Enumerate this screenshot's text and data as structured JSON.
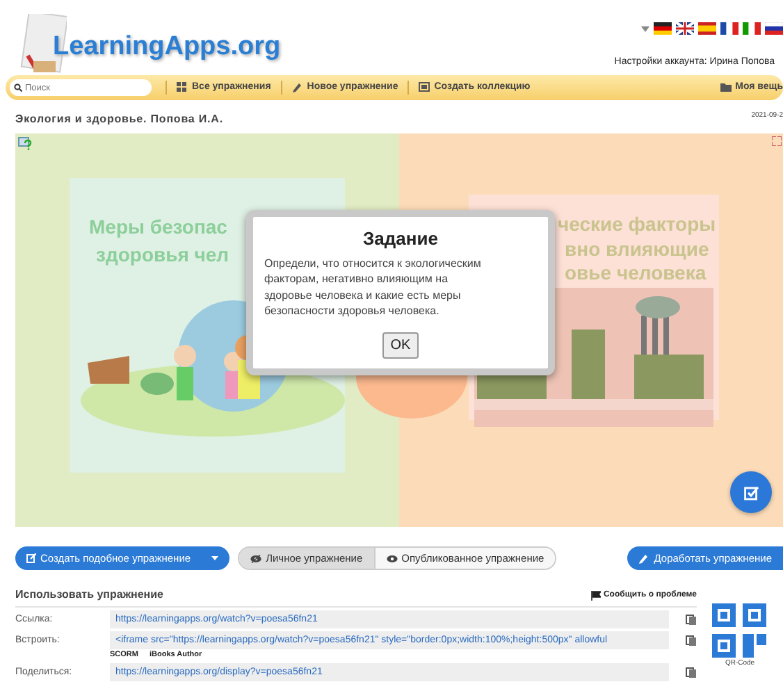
{
  "logo": {
    "text": "LearningApps.org"
  },
  "account": "Настройки аккаунта: Ирина Попова",
  "nav": {
    "search": {
      "placeholder": "Поиск"
    },
    "items": [
      {
        "label": "Все упражнения",
        "kind": "grid"
      },
      {
        "label": "Новое упражнение",
        "kind": "pencil"
      },
      {
        "label": "Создать коллекцию",
        "kind": "collection"
      }
    ],
    "right": {
      "label": "Моя вещь",
      "kind": "folder"
    }
  },
  "title": "Экология и здоровье. Попова И.А.",
  "date": "2021-09-2",
  "exercise": {
    "panels": [
      {
        "lines": [
          "Меры безопас",
          "здоровья чел"
        ]
      },
      {
        "lines": [
          "ческие  факторы",
          "вно влияющие",
          "овье человека"
        ]
      }
    ],
    "dialog": {
      "title": "Задание",
      "text": "Определи, что относится к экологическим факторам, негативно влияющим на здоровье человека и какие есть меры безопасности здоровья человека.",
      "button": "OK"
    }
  },
  "actions": {
    "create": "Создать подобное упражнение",
    "toggle": [
      {
        "label": "Личное упражнение",
        "selected": true
      },
      {
        "label": "Опубликованное упражнение",
        "selected": false
      }
    ],
    "edit": "Доработать упражнение"
  },
  "use": {
    "heading": "Использовать упражнение",
    "report": "Сообщить о проблеме",
    "rows": [
      {
        "label": "Ссылка:",
        "value": "https://learningapps.org/watch?v=poesa56fn21"
      },
      {
        "label": "Встроить:",
        "value": "<iframe src=\"https://learningapps.org/watch?v=poesa56fn21\" style=\"border:0px;width:100%;height:500px\" allowful",
        "extras": [
          "SCORM",
          "iBooks Author"
        ]
      },
      {
        "label": "Поделиться:",
        "value": "https://learningapps.org/display?v=poesa56fn21"
      }
    ],
    "qr_caption": "QR-Code"
  }
}
